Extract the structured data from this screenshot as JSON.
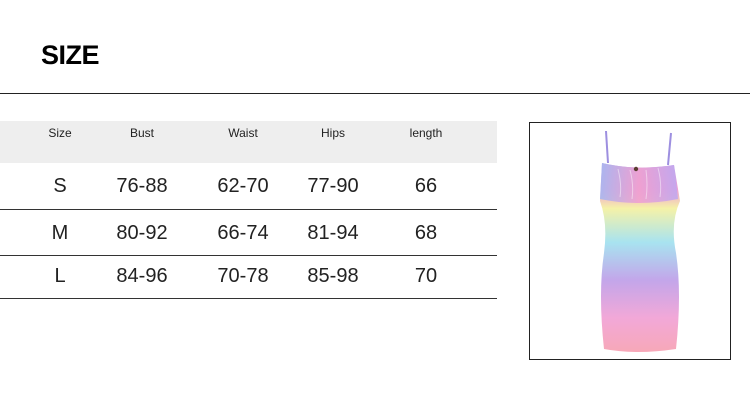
{
  "title": "SIZE",
  "table": {
    "headers": [
      "Size",
      "Bust",
      "Waist",
      "Hips",
      "length"
    ],
    "rows": [
      [
        "S",
        "76-88",
        "62-70",
        "77-90",
        "66"
      ],
      [
        "M",
        "80-92",
        "66-74",
        "81-94",
        "68"
      ],
      [
        "L",
        "84-96",
        "70-78",
        "85-98",
        "70"
      ]
    ]
  },
  "product_image": {
    "description_icon": "dress-image",
    "colors": [
      "#b3a9f2",
      "#a8e3f0",
      "#f5f2a8",
      "#c3a6ea",
      "#f7a8cf"
    ]
  }
}
